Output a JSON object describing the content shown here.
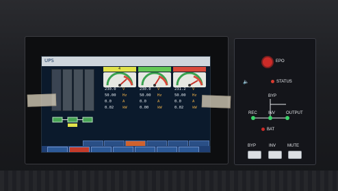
{
  "screen": {
    "app_label": "UPS",
    "meter_header": "4",
    "meters": [
      {
        "name": "meter-1",
        "color": "#e1e24a"
      },
      {
        "name": "meter-2",
        "color": "#64c856"
      },
      {
        "name": "meter-3",
        "color": "#d84a3b"
      }
    ],
    "values": {
      "row1": [
        "230.0",
        "V",
        "230.0",
        "V",
        "231.2",
        "V"
      ],
      "row2": [
        "50.00",
        "Hz",
        "50.00",
        "Hz",
        "50.00",
        "Hz"
      ],
      "row3": [
        "0.0",
        "A",
        "0.0",
        "A",
        "0.0",
        "A"
      ],
      "row4": [
        "0.02",
        "kW",
        "0.00",
        "kW",
        "0.02",
        "kW"
      ]
    },
    "tabs": [
      "",
      "",
      "",
      "",
      "",
      ""
    ],
    "nav": [
      "",
      "",
      "",
      "",
      "",
      "",
      ""
    ]
  },
  "panel": {
    "epo": "EPO",
    "status": "STATUS",
    "byp_label": "BYP",
    "rec_label": "REC",
    "inv_label": "INV",
    "output_label": "OUTPUT",
    "bat_label": "BAT",
    "buttons": [
      "BYP",
      "INV",
      "MUTE"
    ]
  },
  "colors": {
    "screen_bg": "#0b1a2c",
    "accent_blue": "#2a4f86",
    "alarm_red": "#d84a3b",
    "ok_green": "#3bd46a"
  }
}
